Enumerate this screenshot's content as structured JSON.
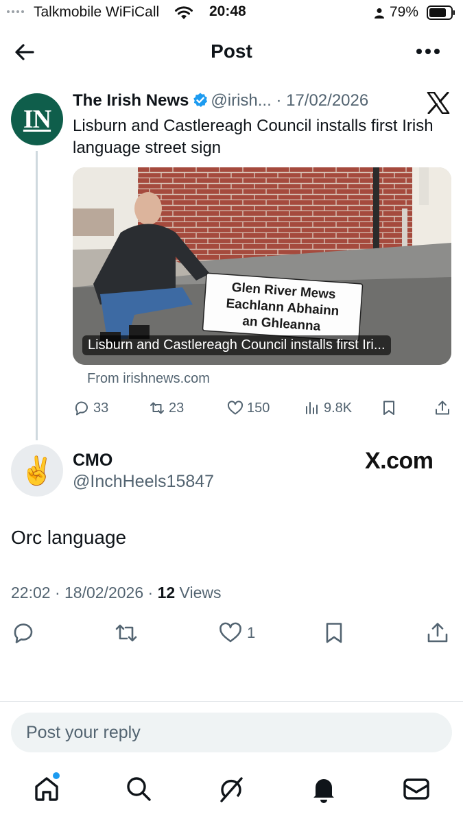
{
  "status_bar": {
    "carrier": "Talkmobile WiFiCall",
    "time": "20:48",
    "battery": "79%"
  },
  "nav": {
    "title": "Post"
  },
  "quoted_post": {
    "author_name": "The Irish News",
    "avatar_text": "IN",
    "handle": "@irish...",
    "date": "· 17/02/2026",
    "text": "Lisburn and Castlereagh Council installs first Irish language street sign",
    "media": {
      "sign_lines": [
        "Glen River Mews",
        "Eachlann Abhainn",
        "an Ghleanna"
      ],
      "caption": "Lisburn and Castlereagh Council installs first Iri..."
    },
    "source": "From irishnews.com",
    "stats": {
      "replies": "33",
      "reposts": "23",
      "likes": "150",
      "views": "9.8K"
    },
    "colors": {
      "avatar_bg": "#0f5e4b",
      "verified": "#1d9bf0"
    }
  },
  "reply_post": {
    "author_name": "CMO",
    "handle": "@InchHeels15847",
    "avatar_emoji": "✌️",
    "watermark": "X.com",
    "text": "Orc language",
    "timestamp": "22:02 · 18/02/2026 ·",
    "view_count": "12",
    "views_label": "Views",
    "likes": "1"
  },
  "composer": {
    "placeholder": "Post your reply"
  },
  "tabbar": {
    "items": [
      "home-icon",
      "search-icon",
      "grok-icon",
      "notifications-icon",
      "messages-icon"
    ],
    "home_badge": true
  }
}
